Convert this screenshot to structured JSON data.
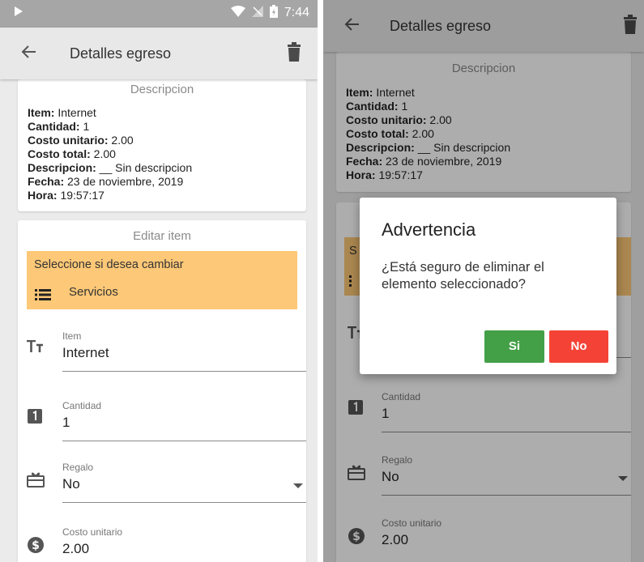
{
  "status": {
    "time": "7:44"
  },
  "app": {
    "title": "Detalles egreso"
  },
  "details": {
    "title": "Descripcion",
    "rows": [
      {
        "key": "Item:",
        "value": " Internet"
      },
      {
        "key": "Cantidad:",
        "value": " 1"
      },
      {
        "key": "Costo unitario:",
        "value": " 2.00"
      },
      {
        "key": "Costo total:",
        "value": " 2.00"
      },
      {
        "key": "Descripcion:",
        "value": " __ Sin descripcion"
      },
      {
        "key": "Fecha:",
        "value": " 23 de noviembre, 2019"
      },
      {
        "key": "Hora:",
        "value": " 19:57:17"
      }
    ]
  },
  "edit": {
    "title": "Editar item",
    "category_prompt": "Seleccione si desea cambiar",
    "category": "Servicios",
    "item_label": "Item",
    "item_value": "Internet",
    "quantity_label": "Cantidad",
    "quantity_value": "1",
    "gift_label": "Regalo",
    "gift_value": "No",
    "unit_cost_label": "Costo unitario",
    "unit_cost_value": "2.00"
  },
  "dialog": {
    "title": "Advertencia",
    "message": "¿Está seguro de eliminar el elemento seleccionado?",
    "yes_label": "Si",
    "no_label": "No"
  },
  "colors": {
    "accent": "#fdc877",
    "yes": "#43a047",
    "no": "#f44336"
  },
  "icons": [
    "back-arrow-icon",
    "trash-icon",
    "list-icon",
    "text-size-icon",
    "number-one-icon",
    "gift-icon",
    "dollar-icon",
    "dropdown-arrow-icon",
    "wifi-icon",
    "signal-icon",
    "battery-icon",
    "play-icon"
  ]
}
